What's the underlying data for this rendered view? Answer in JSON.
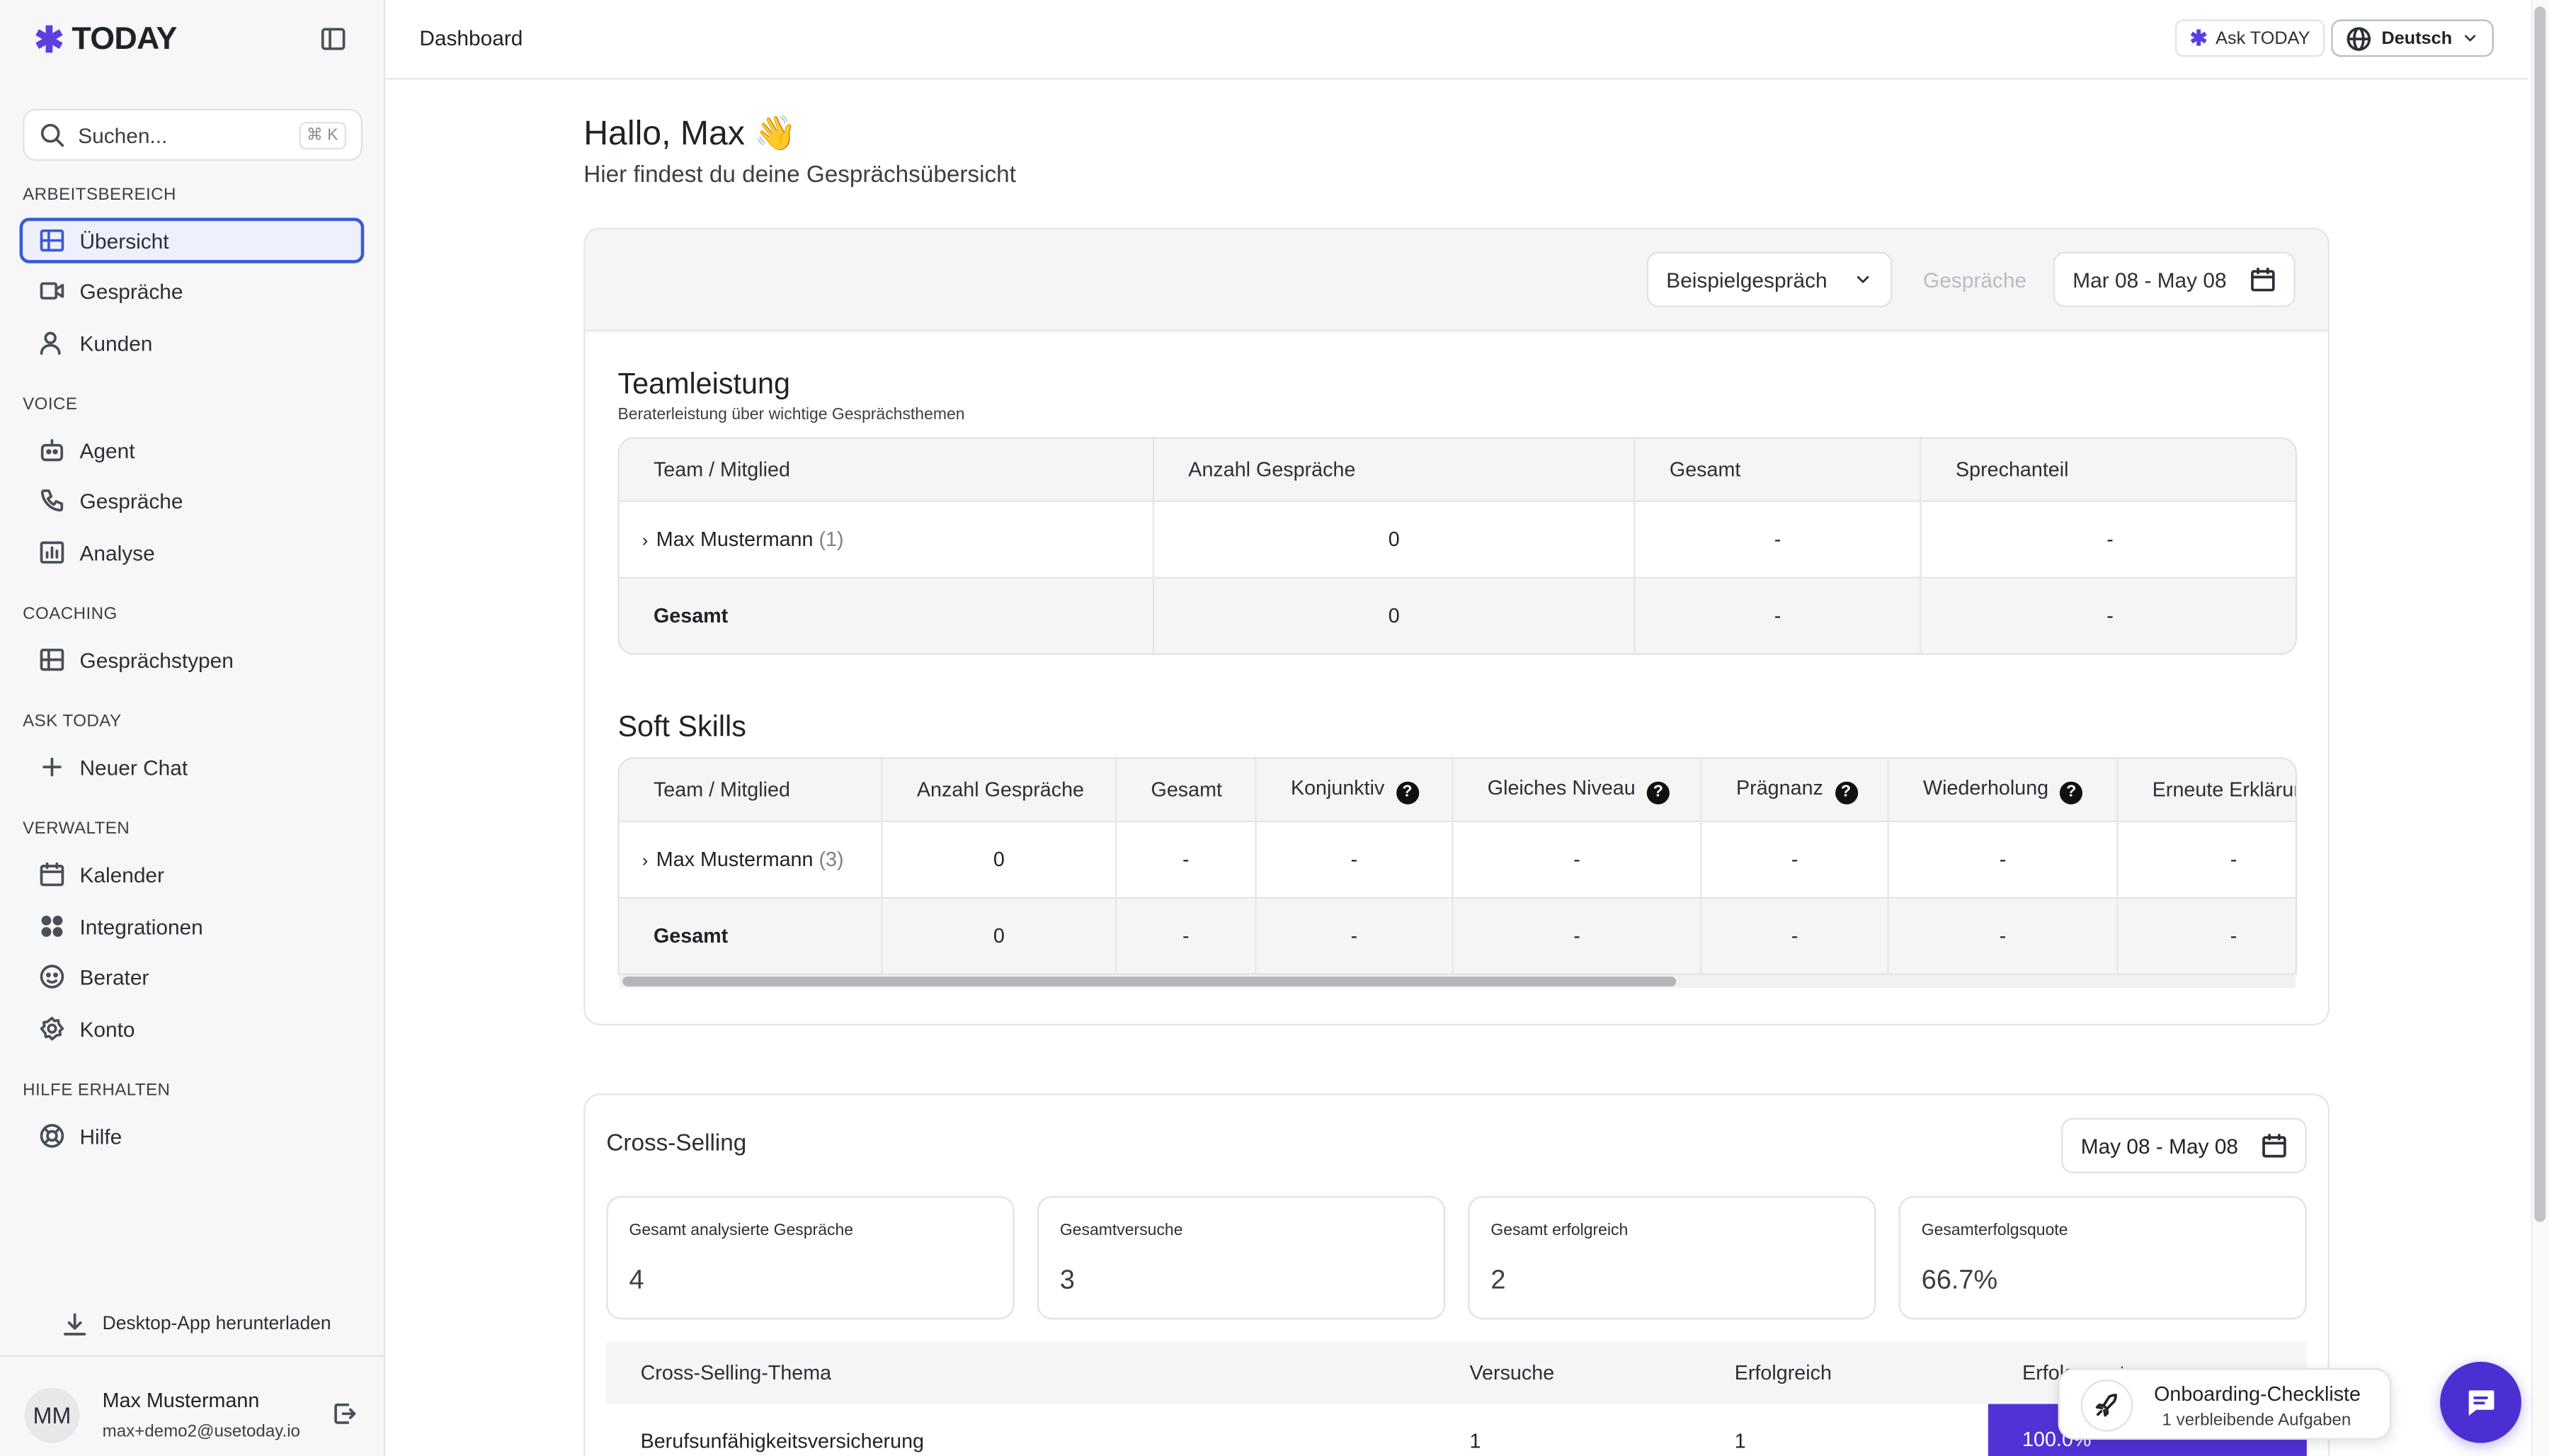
{
  "app": {
    "name": "TODAY",
    "brand_color": "#5b3fe0"
  },
  "sidebar": {
    "search": {
      "placeholder": "Suchen...",
      "shortcut": "⌘ K"
    },
    "sections": [
      {
        "title": "ARBEITSBEREICH",
        "items": [
          {
            "label": "Übersicht",
            "icon": "grid-icon",
            "active": true
          },
          {
            "label": "Gespräche",
            "icon": "video-icon"
          },
          {
            "label": "Kunden",
            "icon": "users-icon"
          }
        ]
      },
      {
        "title": "VOICE",
        "items": [
          {
            "label": "Agent",
            "icon": "robot-icon"
          },
          {
            "label": "Gespräche",
            "icon": "phone-icon"
          },
          {
            "label": "Analyse",
            "icon": "chart-icon"
          }
        ]
      },
      {
        "title": "COACHING",
        "items": [
          {
            "label": "Gesprächstypen",
            "icon": "grid-icon"
          }
        ]
      },
      {
        "title": "ASK TODAY",
        "items": [
          {
            "label": "Neuer Chat",
            "icon": "plus-icon"
          }
        ]
      },
      {
        "title": "VERWALTEN",
        "items": [
          {
            "label": "Kalender",
            "icon": "calendar-icon"
          },
          {
            "label": "Integrationen",
            "icon": "apps-icon"
          },
          {
            "label": "Berater",
            "icon": "face-icon"
          },
          {
            "label": "Konto",
            "icon": "gear-icon"
          }
        ]
      },
      {
        "title": "HILFE ERHALTEN",
        "items": [
          {
            "label": "Hilfe",
            "icon": "lifebuoy-icon"
          }
        ]
      }
    ],
    "download": "Desktop-App herunterladen",
    "user": {
      "initials": "MM",
      "name": "Max Mustermann",
      "email": "max+demo2@usetoday.io"
    }
  },
  "topbar": {
    "breadcrumb": "Dashboard",
    "ask_label": "Ask TODAY",
    "language": "Deutsch"
  },
  "main": {
    "greeting": "Hallo, Max 👋",
    "subtitle": "Hier findest du deine Gesprächsübersicht",
    "filters": {
      "conversation": "Beispielgespräch",
      "type": "Gespräche",
      "date_range": "Mar 08 - May 08"
    },
    "team": {
      "title": "Teamleistung",
      "subtitle": "Beraterleistung über wichtige Gesprächsthemen",
      "columns": [
        "Team / Mitglied",
        "Anzahl Gespräche",
        "Gesamt",
        "Sprechanteil"
      ],
      "row": {
        "name": "Max Mustermann",
        "count": "(1)",
        "values": [
          "0",
          "-",
          "-"
        ]
      },
      "total": {
        "label": "Gesamt",
        "values": [
          "0",
          "-",
          "-"
        ]
      }
    },
    "soft": {
      "title": "Soft Skills",
      "columns": [
        "Team / Mitglied",
        "Anzahl Gespräche",
        "Gesamt",
        "Konjunktiv",
        "Gleiches Niveau",
        "Prägnanz",
        "Wiederholung",
        "Erneute Erklärun"
      ],
      "row": {
        "name": "Max Mustermann",
        "count": "(3)",
        "values": [
          "0",
          "-",
          "-",
          "-",
          "-",
          "-",
          "-"
        ]
      },
      "total": {
        "label": "Gesamt",
        "values": [
          "0",
          "-",
          "-",
          "-",
          "-",
          "-",
          "-"
        ]
      }
    },
    "cross": {
      "title": "Cross-Selling",
      "date_range": "May 08 - May 08",
      "kpis": [
        {
          "label": "Gesamt analysierte Gespräche",
          "value": "4"
        },
        {
          "label": "Gesamtversuche",
          "value": "3"
        },
        {
          "label": "Gesamt erfolgreich",
          "value": "2"
        },
        {
          "label": "Gesamterfolgsquote",
          "value": "66.7%"
        }
      ],
      "columns": [
        "Cross-Selling-Thema",
        "Versuche",
        "Erfolgreich",
        "Erfolgsquote"
      ],
      "row": {
        "topic": "Berufsunfähigkeitsversicherung",
        "attempts": "1",
        "success": "1",
        "rate": "100.0%"
      }
    },
    "onboarding": {
      "title": "Onboarding-Checkliste",
      "subtitle": "1 verbleibende Aufgaben"
    }
  }
}
